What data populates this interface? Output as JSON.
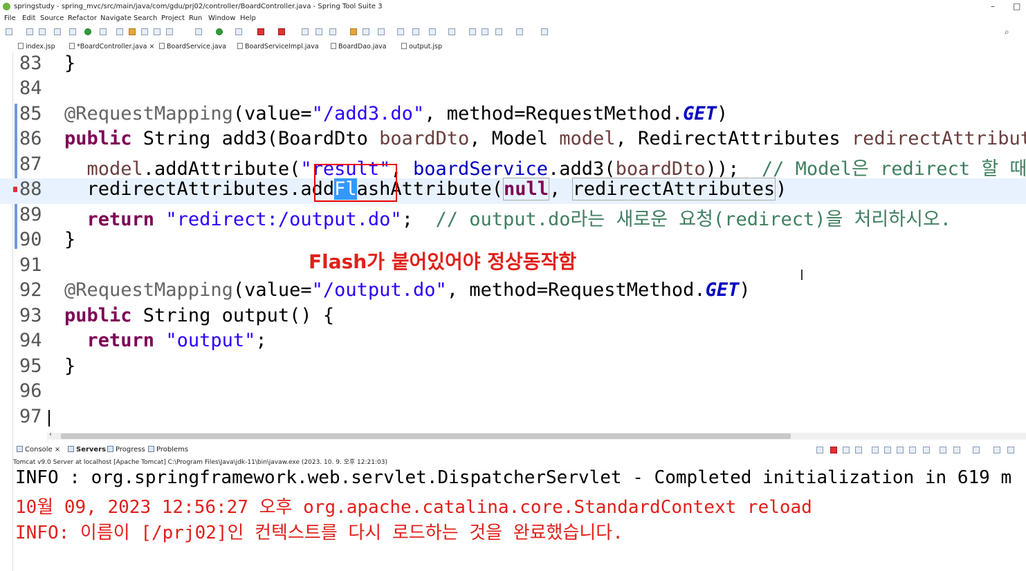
{
  "window": {
    "title": "springstudy - spring_mvc/src/main/java/com/gdu/prj02/controller/BoardController.java - Spring Tool Suite 3",
    "controls": [
      "–",
      "□"
    ]
  },
  "menu": [
    "File",
    "Edit",
    "Source",
    "Refactor",
    "Navigate",
    "Search",
    "Project",
    "Run",
    "Window",
    "Help"
  ],
  "editor_tabs": [
    {
      "label": "index.jsp"
    },
    {
      "label": "*BoardController.java",
      "close": "×"
    },
    {
      "label": "BoardService.java"
    },
    {
      "label": "BoardServiceImpl.java"
    },
    {
      "label": "BoardDao.java"
    },
    {
      "label": "output.jsp"
    }
  ],
  "code": {
    "ln83": "83",
    "ln84": "84",
    "ln85": "85",
    "ln86": "86",
    "ln87": "87",
    "ln88": "88",
    "ln89": "89",
    "ln90": "90",
    "ln91": "91",
    "ln92": "92",
    "ln93": "93",
    "ln94": "94",
    "ln95": "95",
    "ln96": "96",
    "ln97": "97",
    "l83": "}",
    "l85_ann": "@RequestMapping",
    "l85_a": "(value=",
    "l85_str": "\"/add3.do\"",
    "l85_b": ", method=RequestMethod.",
    "l85_get": "GET",
    "l85_c": ")",
    "l86_kw": "public",
    "l86_a": " String add3(BoardDto ",
    "l86_p1": "boardDto",
    "l86_b": ", Model ",
    "l86_p2": "model",
    "l86_c": ", RedirectAttributes ",
    "l86_p3": "redirectAttributes",
    "l87_a": "  ",
    "l87_model": "model",
    "l87_b": ".addAttribute(",
    "l87_str": "\"result\"",
    "l87_c": ", ",
    "l87_fld": "boardService",
    "l87_d": ".add3(",
    "l87_p": "boardDto",
    "l87_e": ")); ",
    "l87_cm": " // Model은 redirect 할 때",
    "l88_a": "  redirectAttributes.add",
    "l88_hl": "Fl",
    "l88_b": "ashAttribute(",
    "l88_null": "null",
    "l88_c": ", ",
    "l88_box": "redirectAttributes",
    "l88_d": ")",
    "l89_a": "  ",
    "l89_kw": "return",
    "l89_b": " ",
    "l89_str": "\"redirect:/output.do\"",
    "l89_c": "; ",
    "l89_cm": " // output.do라는 새로운 요청(redirect)을 처리하시오.",
    "l90": "}",
    "l92_ann": "@RequestMapping",
    "l92_a": "(value=",
    "l92_str": "\"/output.do\"",
    "l92_b": ", method=RequestMethod.",
    "l92_get": "GET",
    "l92_c": ")",
    "l93_kw": "public",
    "l93_a": " String output() {",
    "l94_a": "  ",
    "l94_kw": "return",
    "l94_b": " ",
    "l94_str": "\"output\"",
    "l94_c": ";",
    "l95": "}"
  },
  "annotation_text": "Flash가 붙어있어야 정상동작함",
  "console_tabs": [
    {
      "label": "Console",
      "close": "×"
    },
    {
      "label": "Servers"
    },
    {
      "label": "Progress"
    },
    {
      "label": "Problems"
    }
  ],
  "console_description": "Tomcat v9.0 Server at localhost [Apache Tomcat] C:\\Program Files\\Java\\jdk-11\\bin\\javaw.exe  (2023. 10. 9. 오후 12:21:03)",
  "console_lines": [
    "INFO : org.springframework.web.servlet.DispatcherServlet - Completed initialization in 619 m",
    "10월 09, 2023 12:56:27 오후 org.apache.catalina.core.StandardContext reload",
    "INFO: 이름이 [/prj02]인 컨텍스트를 다시 로드하는 것을 완료했습니다."
  ],
  "colors": {
    "keyword": "#7f0055",
    "string": "#2a00ff",
    "comment": "#3f7f5f",
    "callout": "#e0201a"
  }
}
